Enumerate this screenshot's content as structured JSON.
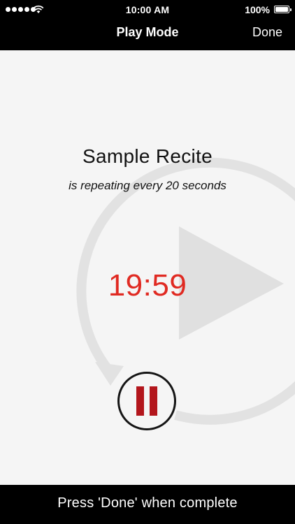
{
  "status_bar": {
    "time": "10:00 AM",
    "battery_percent": "100%",
    "icons": {
      "signal": "signal-strength-icon",
      "wifi": "wifi-icon",
      "battery": "battery-icon"
    }
  },
  "nav_bar": {
    "title": "Play Mode",
    "done_label": "Done"
  },
  "main": {
    "recite_name": "Sample Recite",
    "repeat_text": "is repeating every 20 seconds",
    "countdown": "19:59",
    "background_icons": [
      "repeat-arrow-icon",
      "play-icon"
    ],
    "pause_icon": "pause-icon"
  },
  "footer": {
    "hint": "Press 'Done' when complete"
  },
  "colors": {
    "bars": "#000000",
    "background": "#f5f5f5",
    "countdown": "#e02a22",
    "pause": "#b3161c",
    "decor": "#e0e0e0"
  }
}
